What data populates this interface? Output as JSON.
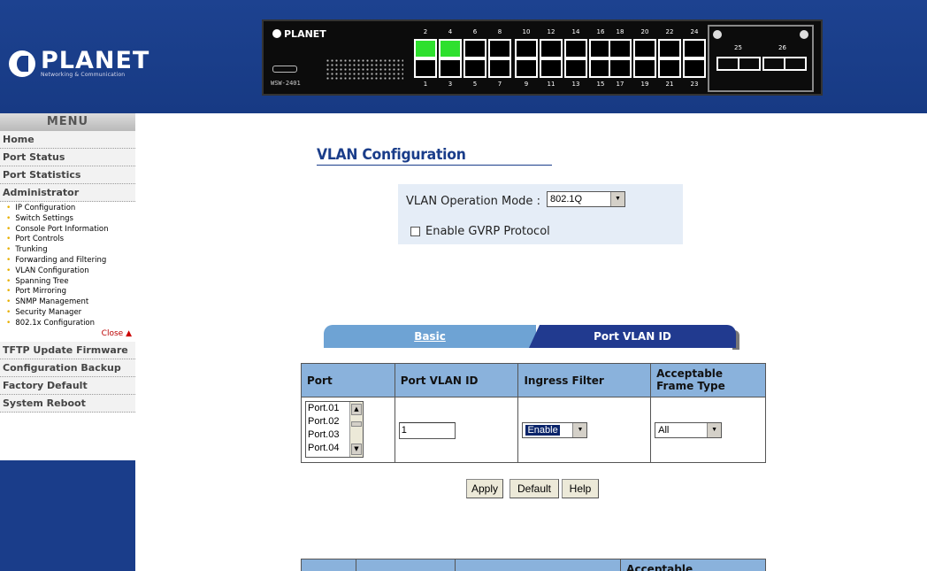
{
  "header": {
    "logo_name": "PLANET",
    "logo_tagline": "Networking & Communication",
    "device": {
      "brand": "PLANET",
      "model": "WSW-2401",
      "ports_top": [
        "2",
        "4",
        "6",
        "8",
        "10",
        "12",
        "14",
        "16",
        "18",
        "20",
        "22",
        "24"
      ],
      "ports_bottom": [
        "1",
        "3",
        "5",
        "7",
        "9",
        "11",
        "13",
        "15",
        "17",
        "19",
        "21",
        "23"
      ],
      "sfp_labels": [
        "25",
        "26"
      ],
      "active_ports": [
        "2",
        "4"
      ],
      "active_color": "#2ee02e"
    }
  },
  "sidebar": {
    "menu_title": "MENU",
    "top_items": [
      "Home",
      "Port Status",
      "Port Statistics",
      "Administrator"
    ],
    "sub_items": [
      "IP Configuration",
      "Switch Settings",
      "Console Port Information",
      "Port Controls",
      "Trunking",
      "Forwarding and Filtering",
      "VLAN Configuration",
      "Spanning Tree",
      "Port Mirroring",
      "SNMP Management",
      "Security Manager",
      "802.1x Configuration"
    ],
    "close_label": "Close",
    "bottom_items": [
      "TFTP Update Firmware",
      "Configuration Backup",
      "Factory Default",
      "System Reboot"
    ]
  },
  "main": {
    "title": "VLAN Configuration",
    "mode_label": "VLAN Operation Mode :",
    "mode_value": "802.1Q",
    "gvrp_label": "Enable GVRP Protocol",
    "gvrp_checked": false,
    "tabs": {
      "basic": "Basic",
      "port_vlan_id": "Port VLAN ID"
    },
    "table": {
      "headers": [
        "Port",
        "Port VLAN ID",
        "Ingress Filter",
        "Acceptable Frame Type"
      ],
      "port_options": [
        "Port.01",
        "Port.02",
        "Port.03",
        "Port.04"
      ],
      "pvid_value": "1",
      "ingress_value": "Enable",
      "frame_type_value": "All"
    },
    "buttons": {
      "apply": "Apply",
      "default": "Default",
      "help": "Help"
    },
    "second_table_header": "Acceptable"
  },
  "colors": {
    "brand_blue": "#1a3d8a",
    "table_header": "#8ab2dc",
    "tab_basic": "#6ea3d4",
    "tab_active": "#213a8f"
  }
}
